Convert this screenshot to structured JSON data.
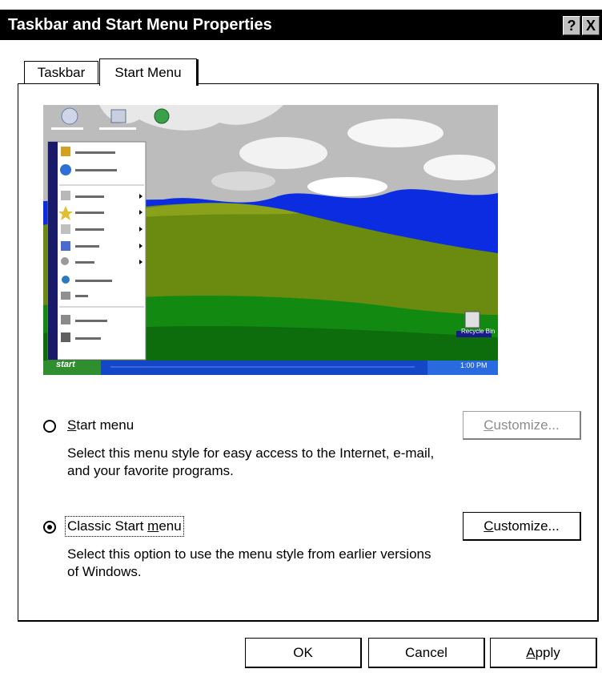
{
  "window": {
    "title": "Taskbar and Start Menu Properties"
  },
  "titlebar_buttons": {
    "help": "?",
    "close": "X"
  },
  "tabs": [
    {
      "label": "Taskbar",
      "selected": false
    },
    {
      "label": "Start Menu",
      "selected": true
    }
  ],
  "preview": {
    "taskbar_start_label": "start",
    "recycle_bin_label": "Recycle Bin",
    "clock_label": "1:00 PM",
    "colors": {
      "sky": "#0b2ce0",
      "hill": "#6b8a10",
      "grass": "#128a12",
      "taskbar": "#1446c8",
      "start": "#2f8f2f"
    }
  },
  "options": {
    "start_menu": {
      "label_first": "S",
      "label_rest": "tart menu",
      "description": "Select this menu style for easy access to the Internet, e-mail, and your favorite programs.",
      "selected": false,
      "customize_first": "C",
      "customize_rest": "ustomize...",
      "customize_enabled": false
    },
    "classic": {
      "label_main": "Classic Start ",
      "label_underlined_m": "m",
      "label_end": "enu",
      "description": "Select this option to use the menu style from earlier versions of Windows.",
      "selected": true,
      "customize_first": "C",
      "customize_rest": "ustomize...",
      "customize_enabled": true
    }
  },
  "footer": {
    "ok": "OK",
    "cancel": "Cancel",
    "apply_first": "A",
    "apply_rest": "pply"
  }
}
